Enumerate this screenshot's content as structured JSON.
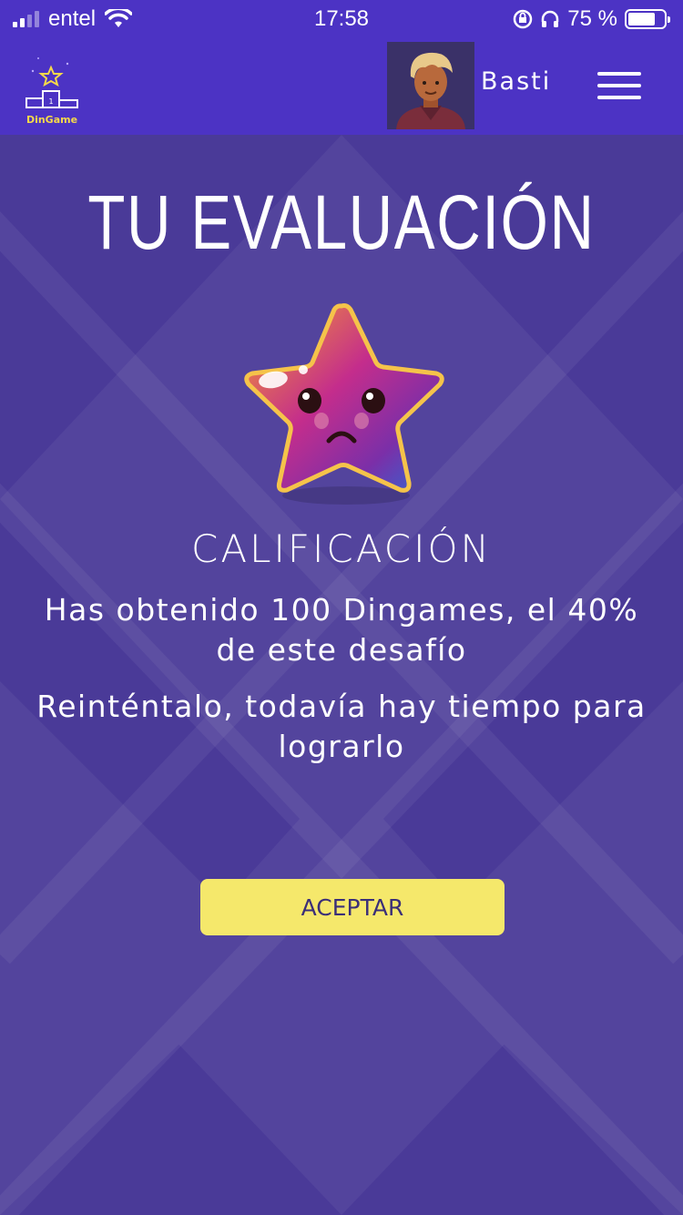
{
  "status_bar": {
    "carrier": "entel",
    "time": "17:58",
    "battery": "75 %",
    "battery_level": 0.75
  },
  "header": {
    "logo_text": "DinGame",
    "user_name": "Basti",
    "icons": [
      "signal-icon",
      "wifi-icon",
      "orientation-lock-icon",
      "headphones-icon",
      "battery-icon",
      "menu-icon"
    ]
  },
  "result": {
    "title": "TU EVALUACIÓN",
    "subtitle": "CALIFICACIÓN",
    "message_line1": "Has obtenido 100 Dingames, el 40% de este desafío",
    "message_line2": "Reinténtalo, todavía hay tiempo para lograrlo",
    "button_label": "ACEPTAR"
  },
  "colors": {
    "header_bg": "#4c33c4",
    "page_bg": "#4a3a98",
    "button_bg": "#f5e86b",
    "button_text": "#3b2f78"
  }
}
